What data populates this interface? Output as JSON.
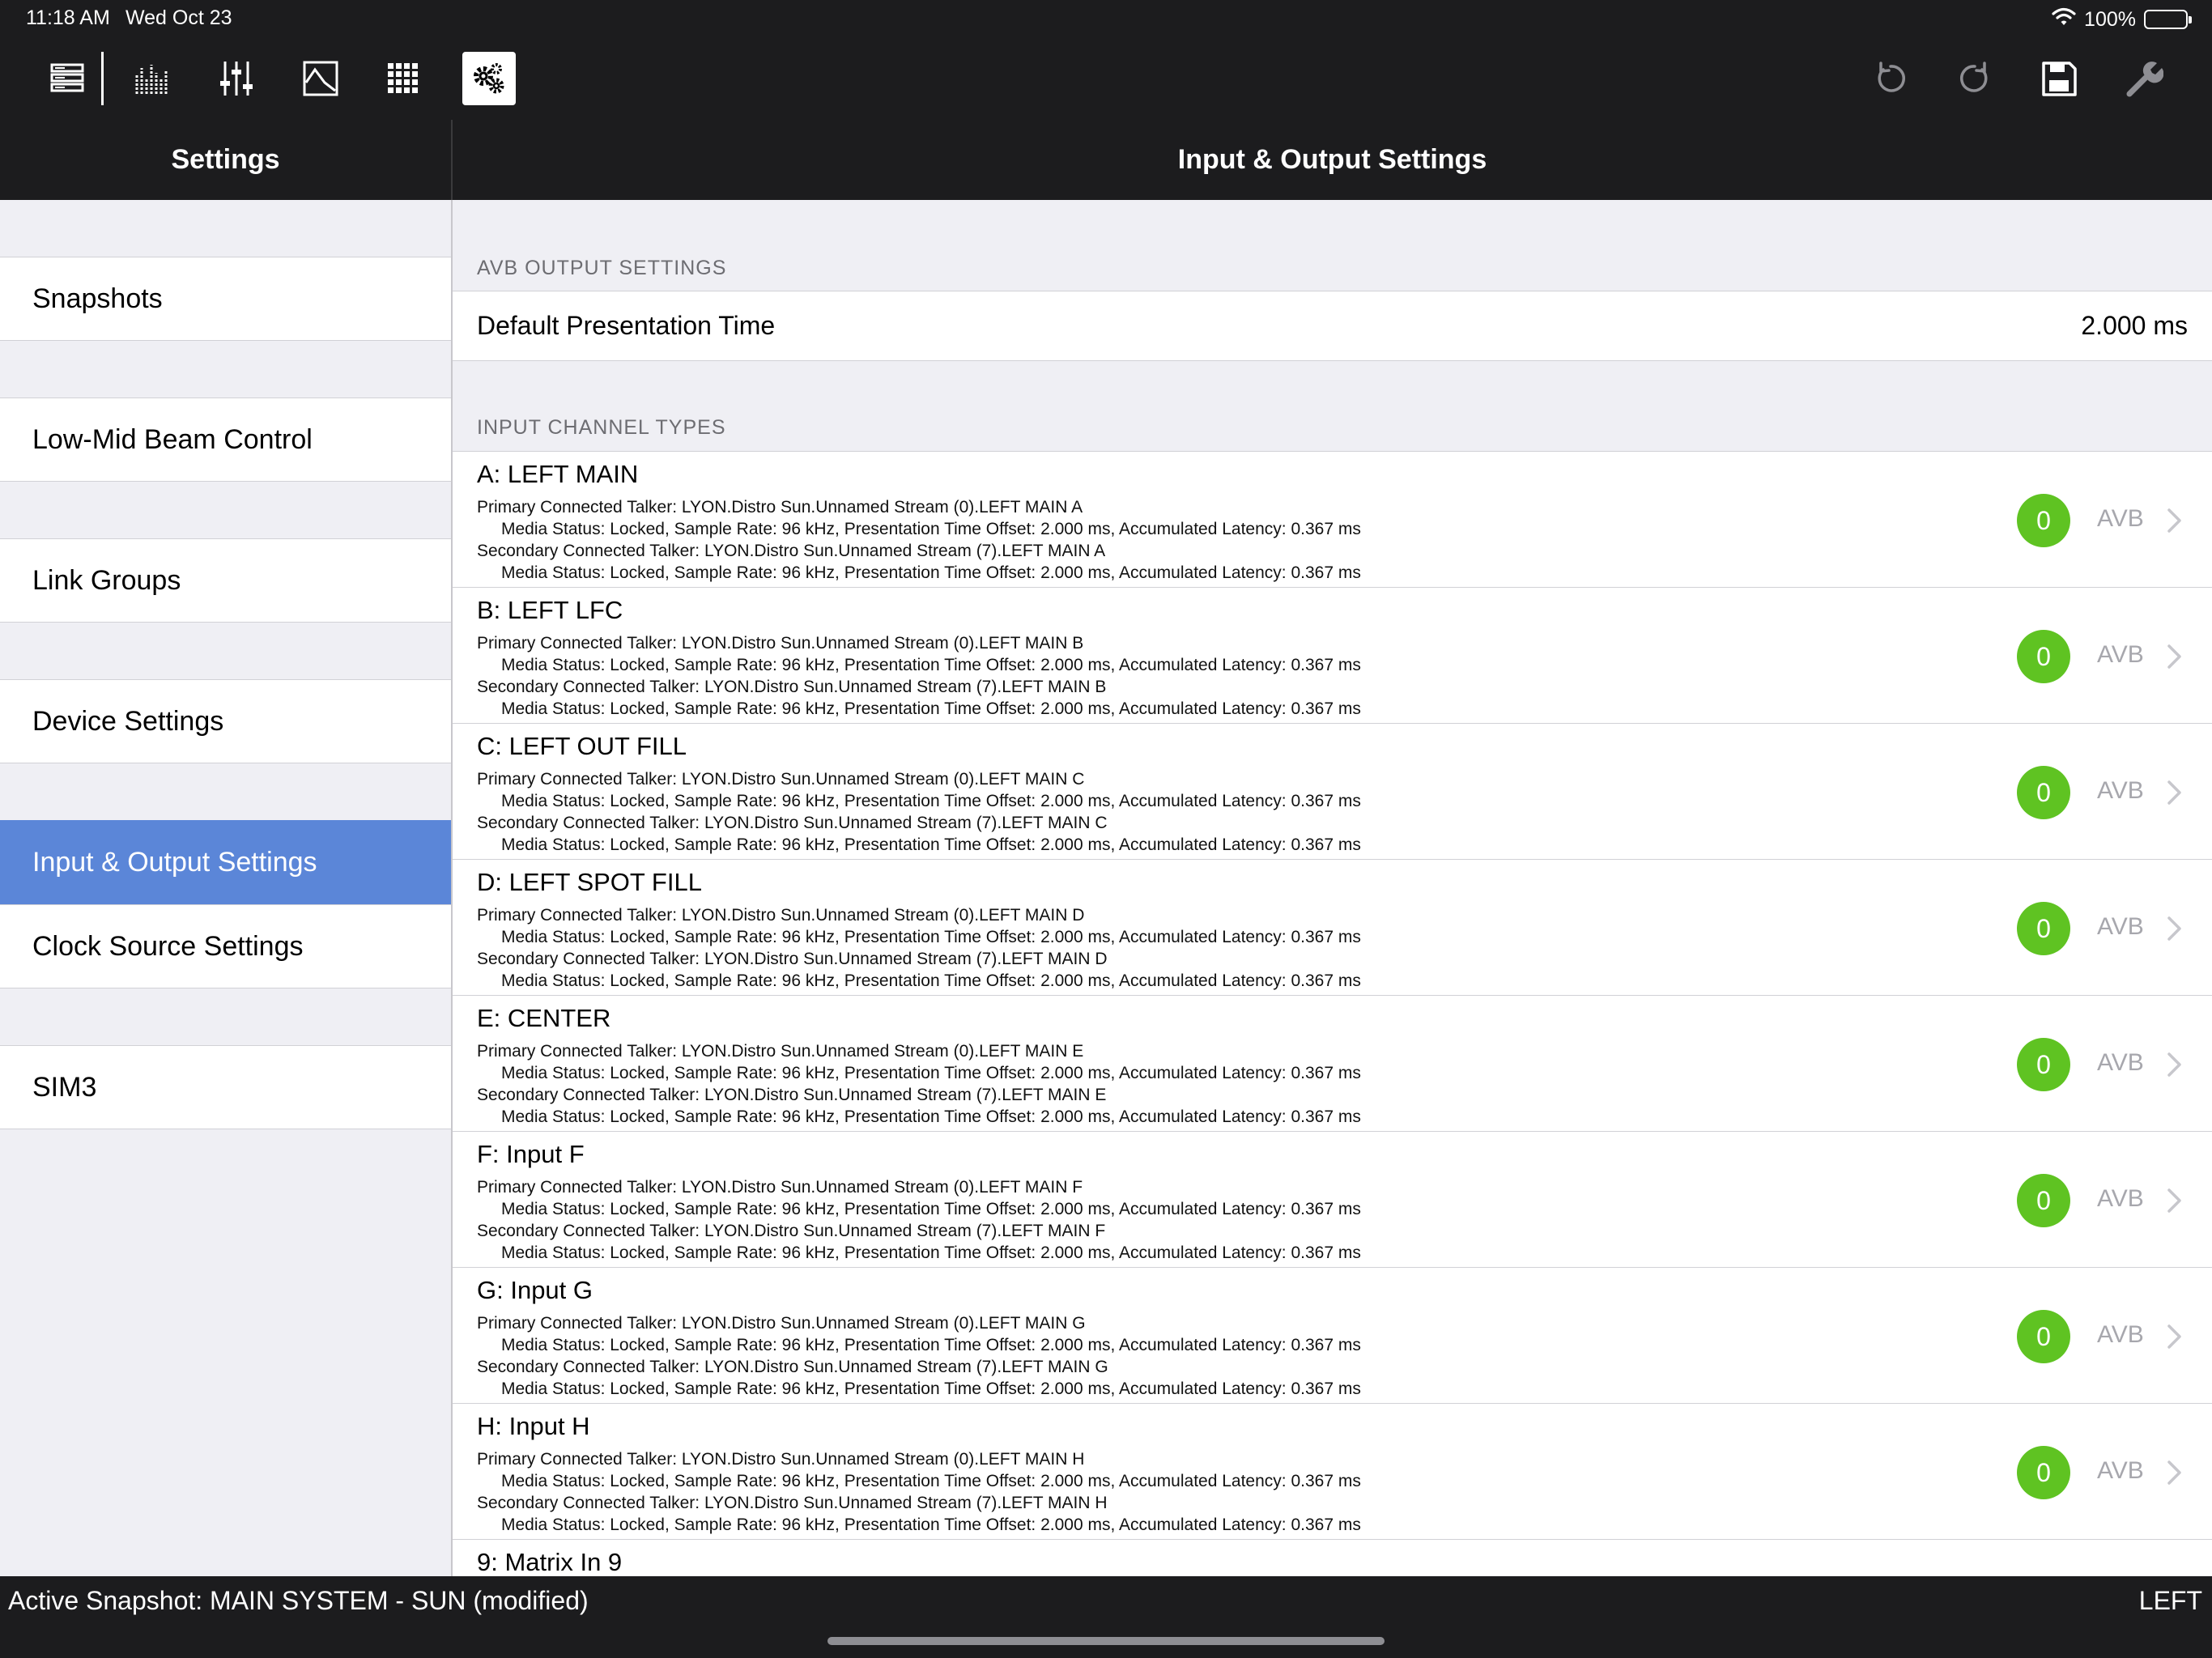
{
  "status_bar": {
    "time": "11:18 AM",
    "date": "Wed Oct 23",
    "battery": "100%"
  },
  "toolbar": {
    "left_icons": [
      "rack-icon",
      "meter-bank-icon",
      "faders-icon",
      "eq-graph-icon",
      "grid-icon",
      "settings-gears-icon"
    ],
    "active_icon": "settings-gears-icon",
    "right_icons": [
      "undo-icon",
      "redo-icon",
      "save-icon",
      "wrench-icon"
    ]
  },
  "headers": {
    "left_title": "Settings",
    "right_title": "Input & Output Settings"
  },
  "sidebar": {
    "items": [
      {
        "label": "Snapshots"
      },
      {
        "label": "Low-Mid Beam Control"
      },
      {
        "label": "Link Groups"
      },
      {
        "label": "Device Settings"
      },
      {
        "label": "Input & Output Settings",
        "active": true
      },
      {
        "label": "Clock Source Settings"
      },
      {
        "label": "SIM3"
      }
    ]
  },
  "avb_output": {
    "section_title": "AVB OUTPUT SETTINGS",
    "presentation_label": "Default Presentation Time",
    "presentation_value": "2.000 ms"
  },
  "input_channels": {
    "section_title": "INPUT CHANNEL TYPES",
    "channels": [
      {
        "title": "A: LEFT MAIN",
        "primary": "Primary Connected Talker: LYON.Distro Sun.Unnamed Stream (0).LEFT MAIN A",
        "primary_status": "Media Status: Locked, Sample Rate: 96 kHz, Presentation Time Offset: 2.000 ms, Accumulated Latency: 0.367 ms",
        "secondary": "Secondary Connected Talker: LYON.Distro Sun.Unnamed Stream (7).LEFT MAIN A",
        "secondary_status": "Media Status: Locked, Sample Rate: 96 kHz, Presentation Time Offset: 2.000 ms, Accumulated Latency: 0.367 ms",
        "badge": "0",
        "type": "AVB"
      },
      {
        "title": "B: LEFT LFC",
        "primary": "Primary Connected Talker: LYON.Distro Sun.Unnamed Stream (0).LEFT MAIN B",
        "primary_status": "Media Status: Locked, Sample Rate: 96 kHz, Presentation Time Offset: 2.000 ms, Accumulated Latency: 0.367 ms",
        "secondary": "Secondary Connected Talker: LYON.Distro Sun.Unnamed Stream (7).LEFT MAIN B",
        "secondary_status": "Media Status: Locked, Sample Rate: 96 kHz, Presentation Time Offset: 2.000 ms, Accumulated Latency: 0.367 ms",
        "badge": "0",
        "type": "AVB"
      },
      {
        "title": "C: LEFT OUT FILL",
        "primary": "Primary Connected Talker: LYON.Distro Sun.Unnamed Stream (0).LEFT MAIN C",
        "primary_status": "Media Status: Locked, Sample Rate: 96 kHz, Presentation Time Offset: 2.000 ms, Accumulated Latency: 0.367 ms",
        "secondary": "Secondary Connected Talker: LYON.Distro Sun.Unnamed Stream (7).LEFT MAIN C",
        "secondary_status": "Media Status: Locked, Sample Rate: 96 kHz, Presentation Time Offset: 2.000 ms, Accumulated Latency: 0.367 ms",
        "badge": "0",
        "type": "AVB"
      },
      {
        "title": "D: LEFT SPOT FILL",
        "primary": "Primary Connected Talker: LYON.Distro Sun.Unnamed Stream (0).LEFT MAIN D",
        "primary_status": "Media Status: Locked, Sample Rate: 96 kHz, Presentation Time Offset: 2.000 ms, Accumulated Latency: 0.367 ms",
        "secondary": "Secondary Connected Talker: LYON.Distro Sun.Unnamed Stream (7).LEFT MAIN D",
        "secondary_status": "Media Status: Locked, Sample Rate: 96 kHz, Presentation Time Offset: 2.000 ms, Accumulated Latency: 0.367 ms",
        "badge": "0",
        "type": "AVB"
      },
      {
        "title": "E: CENTER",
        "primary": "Primary Connected Talker: LYON.Distro Sun.Unnamed Stream (0).LEFT MAIN E",
        "primary_status": "Media Status: Locked, Sample Rate: 96 kHz, Presentation Time Offset: 2.000 ms, Accumulated Latency: 0.367 ms",
        "secondary": "Secondary Connected Talker: LYON.Distro Sun.Unnamed Stream (7).LEFT MAIN E",
        "secondary_status": "Media Status: Locked, Sample Rate: 96 kHz, Presentation Time Offset: 2.000 ms, Accumulated Latency: 0.367 ms",
        "badge": "0",
        "type": "AVB"
      },
      {
        "title": "F: Input F",
        "primary": "Primary Connected Talker: LYON.Distro Sun.Unnamed Stream (0).LEFT MAIN F",
        "primary_status": "Media Status: Locked, Sample Rate: 96 kHz, Presentation Time Offset: 2.000 ms, Accumulated Latency: 0.367 ms",
        "secondary": "Secondary Connected Talker: LYON.Distro Sun.Unnamed Stream (7).LEFT MAIN F",
        "secondary_status": "Media Status: Locked, Sample Rate: 96 kHz, Presentation Time Offset: 2.000 ms, Accumulated Latency: 0.367 ms",
        "badge": "0",
        "type": "AVB"
      },
      {
        "title": "G: Input G",
        "primary": "Primary Connected Talker: LYON.Distro Sun.Unnamed Stream (0).LEFT MAIN G",
        "primary_status": "Media Status: Locked, Sample Rate: 96 kHz, Presentation Time Offset: 2.000 ms, Accumulated Latency: 0.367 ms",
        "secondary": "Secondary Connected Talker: LYON.Distro Sun.Unnamed Stream (7).LEFT MAIN G",
        "secondary_status": "Media Status: Locked, Sample Rate: 96 kHz, Presentation Time Offset: 2.000 ms, Accumulated Latency: 0.367 ms",
        "badge": "0",
        "type": "AVB"
      },
      {
        "title": "H: Input H",
        "primary": "Primary Connected Talker: LYON.Distro Sun.Unnamed Stream (0).LEFT MAIN H",
        "primary_status": "Media Status: Locked, Sample Rate: 96 kHz, Presentation Time Offset: 2.000 ms, Accumulated Latency: 0.367 ms",
        "secondary": "Secondary Connected Talker: LYON.Distro Sun.Unnamed Stream (7).LEFT MAIN H",
        "secondary_status": "Media Status: Locked, Sample Rate: 96 kHz, Presentation Time Offset: 2.000 ms, Accumulated Latency: 0.367 ms",
        "badge": "0",
        "type": "AVB"
      },
      {
        "title": "9: Matrix In 9"
      }
    ]
  },
  "bottom_bar": {
    "active_snapshot": "Active Snapshot: MAIN SYSTEM - SUN (modified)",
    "right_label": "LEFT"
  },
  "colors": {
    "chrome": "#1c1c1e",
    "active_sidebar": "#5b86d8",
    "badge_green": "#5fc322",
    "background": "#efeff4"
  }
}
